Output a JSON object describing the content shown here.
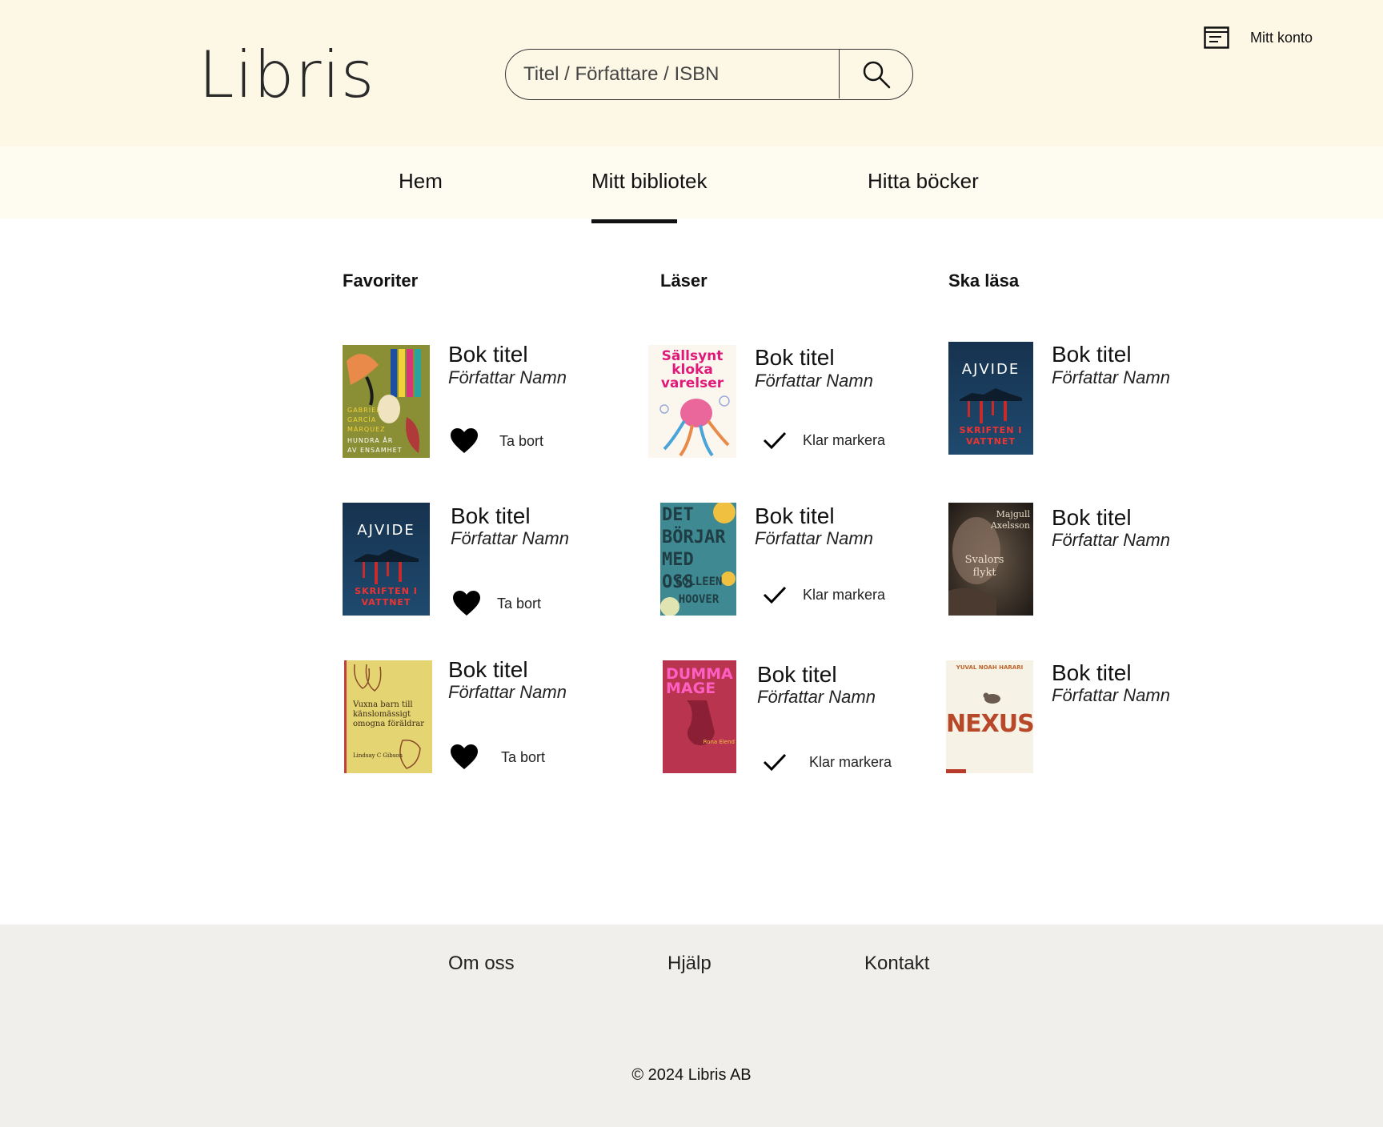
{
  "header": {
    "logo": "Libris",
    "search_placeholder": "Titel / Författare / ISBN",
    "search_icon": "magnifier-icon",
    "account_icon": "account-card-icon",
    "account_label": "Mitt konto"
  },
  "nav": {
    "items": [
      {
        "label": "Hem",
        "active": false
      },
      {
        "label": "Mitt bibliotek",
        "active": true
      },
      {
        "label": "Hitta böcker",
        "active": false
      }
    ]
  },
  "columns": [
    {
      "heading": "Favoriter",
      "action_icon": "heart-icon",
      "books": [
        {
          "title": "Bok titel",
          "author": "Författar Namn",
          "action": "Ta bort",
          "cover": {
            "title": "HUNDRA ÅR AV ENSAMHET",
            "author": "GABRIEL GARCÍA MÁRQUEZ"
          }
        },
        {
          "title": "Bok titel",
          "author": "Författar Namn",
          "action": "Ta bort",
          "cover": {
            "title": "SKRIFTEN I VATTNET",
            "author": "AJVIDE"
          }
        },
        {
          "title": "Bok titel",
          "author": "Författar Namn",
          "action": "Ta bort",
          "cover": {
            "title": "Vuxna barn till känslomässigt omogna föräldrar",
            "author": "Lindsay C Gibson"
          }
        }
      ]
    },
    {
      "heading": "Läser",
      "action_icon": "checkmark-icon",
      "books": [
        {
          "title": "Bok titel",
          "author": "Författar Namn",
          "action": "Klar markera",
          "cover": {
            "title": "Sällsynt kloka varelser",
            "author": ""
          }
        },
        {
          "title": "Bok titel",
          "author": "Författar Namn",
          "action": "Klar markera",
          "cover": {
            "title": "DET BÖRJAR MED OSS",
            "author": "COLLEEN HOOVER"
          }
        },
        {
          "title": "Bok titel",
          "author": "Författar Namn",
          "action": "Klar markera",
          "cover": {
            "title": "DUMMA MAGE",
            "author": "Rona Elend"
          }
        }
      ]
    },
    {
      "heading": "Ska läsa",
      "books": [
        {
          "title": "Bok titel",
          "author": "Författar Namn",
          "cover": {
            "title": "SKRIFTEN I VATTNET",
            "author": "AJVIDE"
          }
        },
        {
          "title": "Bok titel",
          "author": "Författar Namn",
          "cover": {
            "title": "Svalors flykt",
            "author": "Majgull Axelsson"
          }
        },
        {
          "title": "Bok titel",
          "author": "Författar Namn",
          "cover": {
            "title": "NEXUS",
            "author": "YUVAL NOAH HARARI"
          }
        }
      ]
    }
  ],
  "footer": {
    "links": [
      "Om oss",
      "Hjälp",
      "Kontakt"
    ],
    "copyright": "© 2024 Libris AB"
  },
  "colors": {
    "header_bg": "#fdf8e6",
    "nav_bg": "#fefbf0",
    "footer_bg": "#f0efeb"
  }
}
